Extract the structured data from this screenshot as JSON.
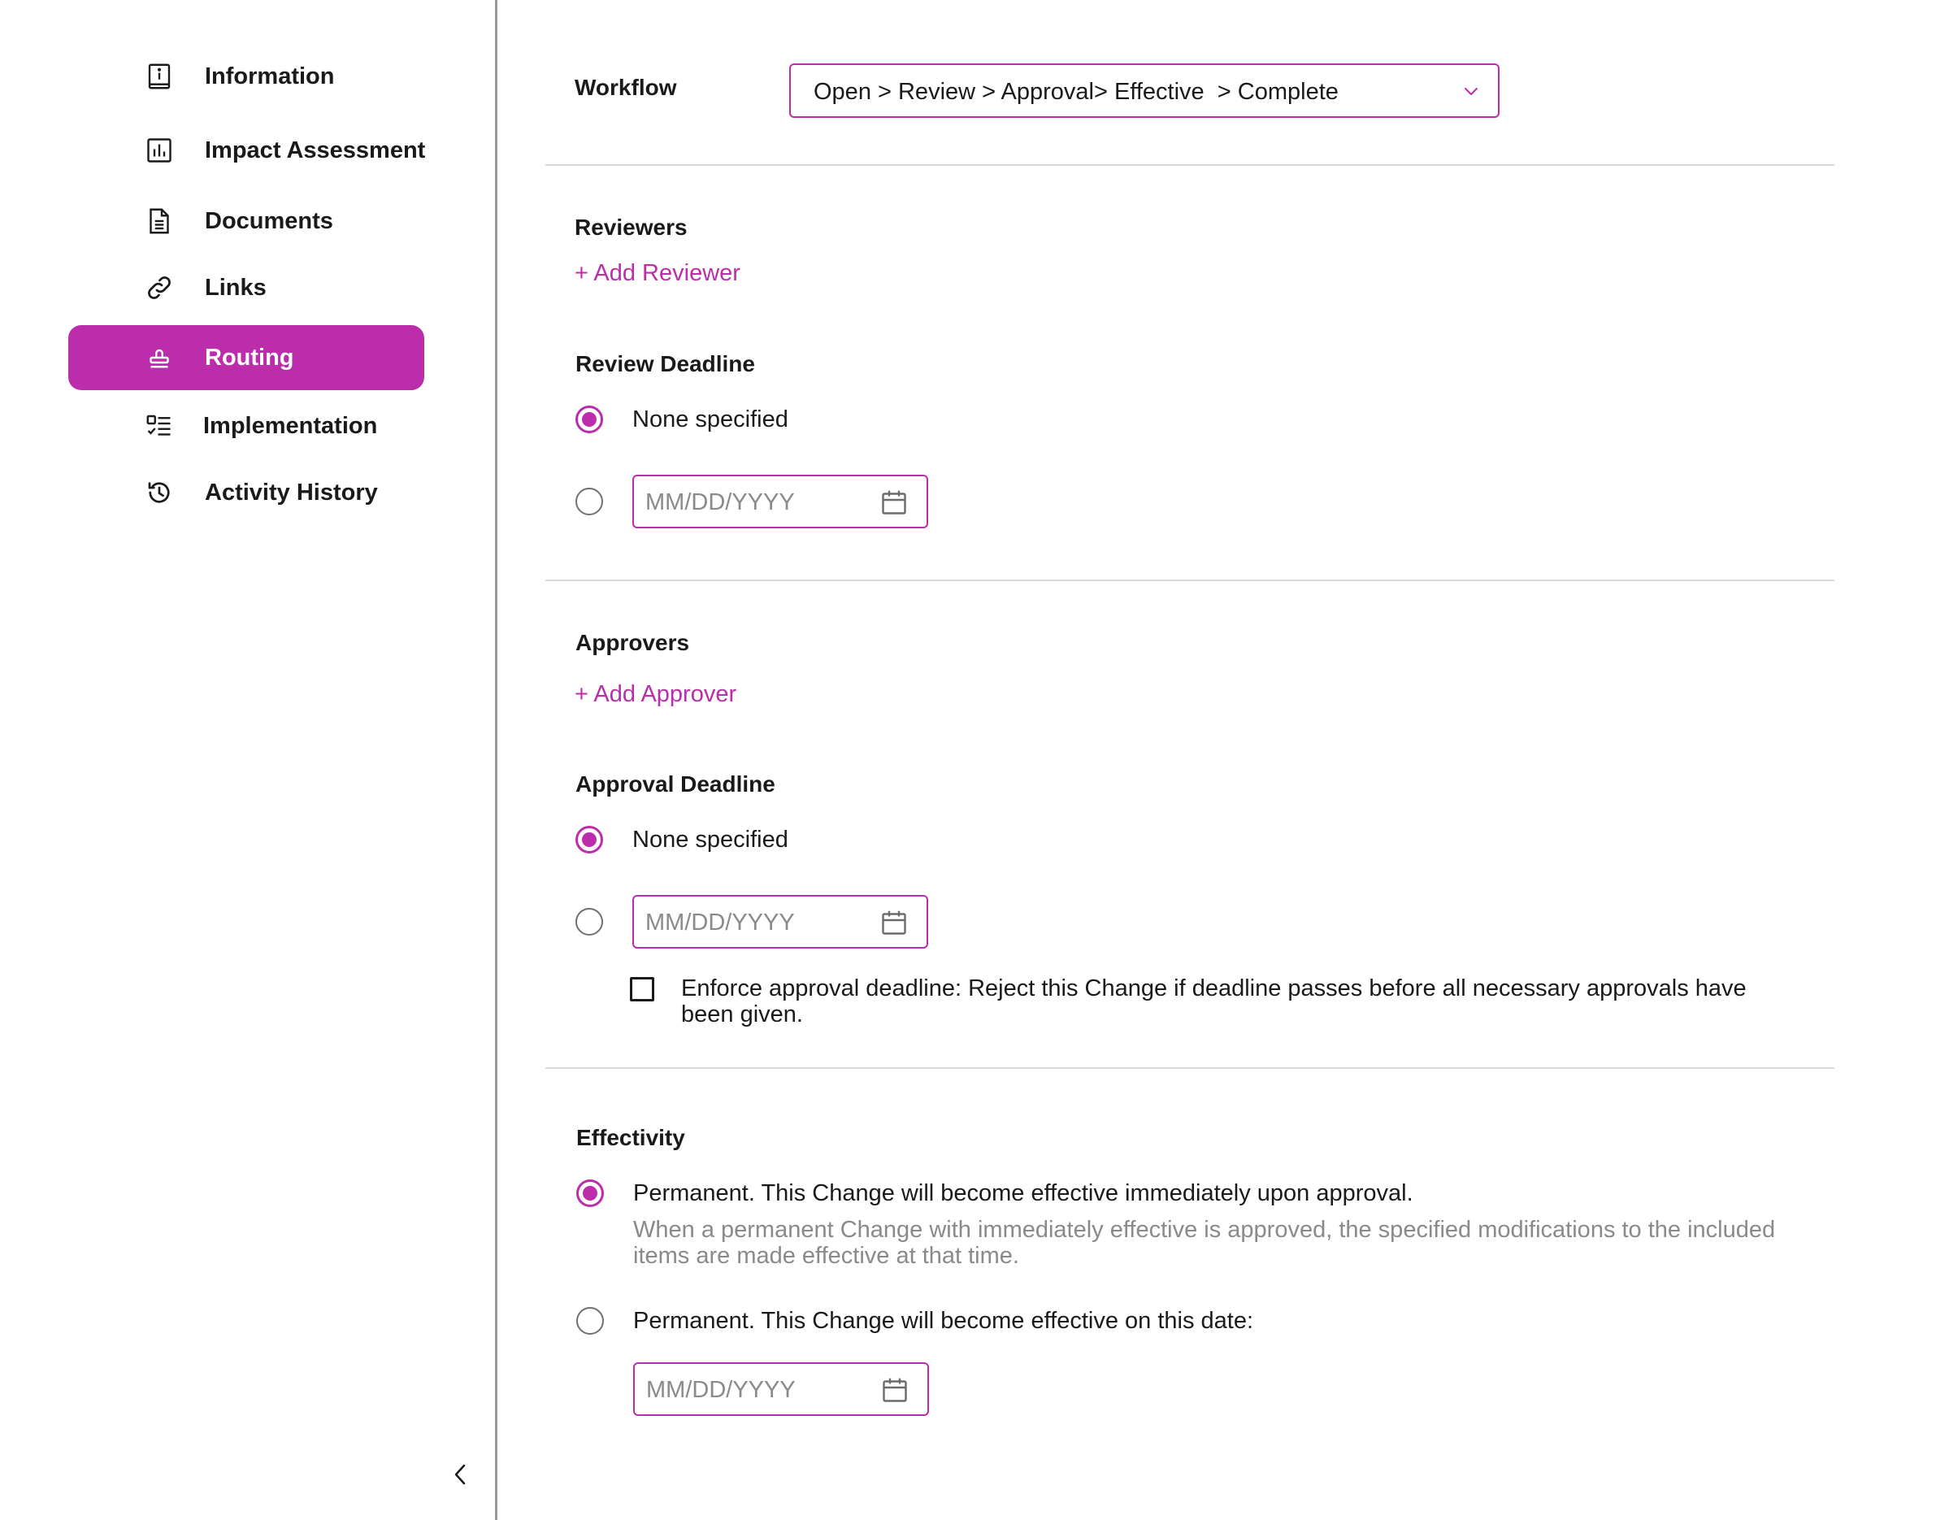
{
  "sidebar": {
    "items": [
      {
        "label": "Information",
        "icon": "info-book-icon"
      },
      {
        "label": "Impact Assessment",
        "icon": "bar-chart-icon"
      },
      {
        "label": "Documents",
        "icon": "document-icon"
      },
      {
        "label": "Links",
        "icon": "link-icon"
      },
      {
        "label": "Routing",
        "icon": "stamp-icon",
        "active": true
      },
      {
        "label": "Implementation",
        "icon": "checklist-icon"
      },
      {
        "label": "Activity History",
        "icon": "history-icon"
      }
    ],
    "collapse_icon": "chevron-left-icon"
  },
  "workflow": {
    "label": "Workflow",
    "value": "Open > Review > Approval> Effective  > Complete",
    "icon": "chevron-down-icon"
  },
  "reviewers": {
    "label": "Reviewers",
    "add_label": "+ Add Reviewer"
  },
  "review_deadline": {
    "label": "Review Deadline",
    "none_label": "None specified",
    "date_placeholder": "MM/DD/YYYY",
    "selected": "none"
  },
  "approvers": {
    "label": "Approvers",
    "add_label": "+ Add Approver"
  },
  "approval_deadline": {
    "label": "Approval Deadline",
    "none_label": "None specified",
    "date_placeholder": "MM/DD/YYYY",
    "selected": "none",
    "enforce_label": "Enforce approval deadline: Reject this Change if deadline passes before all necessary approvals have been given.",
    "enforce_checked": false
  },
  "effectivity": {
    "label": "Effectivity",
    "option_immediate_label": "Permanent. This Change will become effective immediately upon approval.",
    "option_immediate_help": "When a permanent Change with immediately effective is approved, the specified modifications to the included items are made effective at that time.",
    "option_date_label": "Permanent. This Change will become effective on this date:",
    "date_placeholder": "MM/DD/YYYY",
    "selected": "immediate"
  },
  "colors": {
    "accent": "#bb2daa",
    "divider": "#d9d9d9",
    "muted_text": "#8a8a8a"
  }
}
